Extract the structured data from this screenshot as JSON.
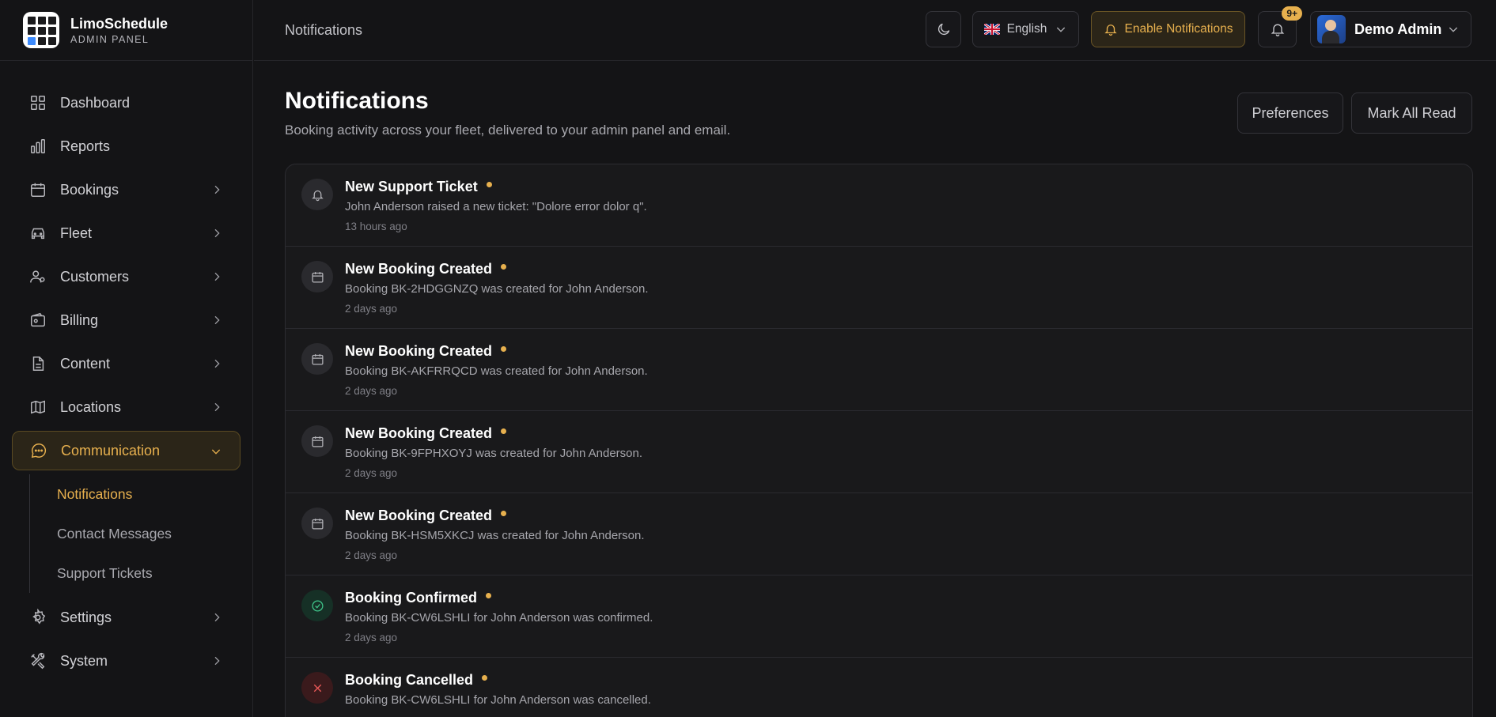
{
  "brand": {
    "title": "LimoSchedule",
    "subtitle": "ADMIN PANEL"
  },
  "sidebar": {
    "items": [
      {
        "label": "Dashboard",
        "icon": "grid-icon"
      },
      {
        "label": "Reports",
        "icon": "bar-chart-icon"
      },
      {
        "label": "Bookings",
        "icon": "calendar-icon"
      },
      {
        "label": "Fleet",
        "icon": "car-icon"
      },
      {
        "label": "Customers",
        "icon": "users-icon"
      },
      {
        "label": "Billing",
        "icon": "wallet-icon"
      },
      {
        "label": "Content",
        "icon": "file-icon"
      },
      {
        "label": "Locations",
        "icon": "map-icon"
      },
      {
        "label": "Communication",
        "icon": "chat-icon"
      },
      {
        "label": "Settings",
        "icon": "gear-icon"
      },
      {
        "label": "System",
        "icon": "tools-icon"
      }
    ],
    "communication_sub": [
      {
        "label": "Notifications"
      },
      {
        "label": "Contact Messages"
      },
      {
        "label": "Support Tickets"
      }
    ]
  },
  "topbar": {
    "breadcrumb": "Notifications",
    "language": "English",
    "enable_label": "Enable Notifications",
    "badge": "9+",
    "user_name": "Demo Admin"
  },
  "page": {
    "title": "Notifications",
    "subtitle": "Booking activity across your fleet, delivered to your admin panel and email.",
    "preferences_label": "Preferences",
    "mark_all_label": "Mark All Read"
  },
  "notifications": [
    {
      "title": "New Support Ticket",
      "message": "John Anderson raised a new ticket: \"Dolore error dolor q\".",
      "time": "13 hours ago",
      "icon": "bell-icon"
    },
    {
      "title": "New Booking Created",
      "message": "Booking BK-2HDGGNZQ was created for John Anderson.",
      "time": "2 days ago",
      "icon": "calendar-icon"
    },
    {
      "title": "New Booking Created",
      "message": "Booking BK-AKFRRQCD was created for John Anderson.",
      "time": "2 days ago",
      "icon": "calendar-icon"
    },
    {
      "title": "New Booking Created",
      "message": "Booking BK-9FPHXOYJ was created for John Anderson.",
      "time": "2 days ago",
      "icon": "calendar-icon"
    },
    {
      "title": "New Booking Created",
      "message": "Booking BK-HSM5XKCJ was created for John Anderson.",
      "time": "2 days ago",
      "icon": "calendar-icon"
    },
    {
      "title": "Booking Confirmed",
      "message": "Booking BK-CW6LSHLI for John Anderson was confirmed.",
      "time": "2 days ago",
      "icon": "check-circle-icon"
    },
    {
      "title": "Booking Cancelled",
      "message": "Booking BK-CW6LSHLI for John Anderson was cancelled.",
      "time": "",
      "icon": "x-icon"
    }
  ],
  "colors": {
    "accent": "#e7b04e",
    "background": "#141416",
    "success": "#3fc58a",
    "danger": "#ef5a5a"
  }
}
